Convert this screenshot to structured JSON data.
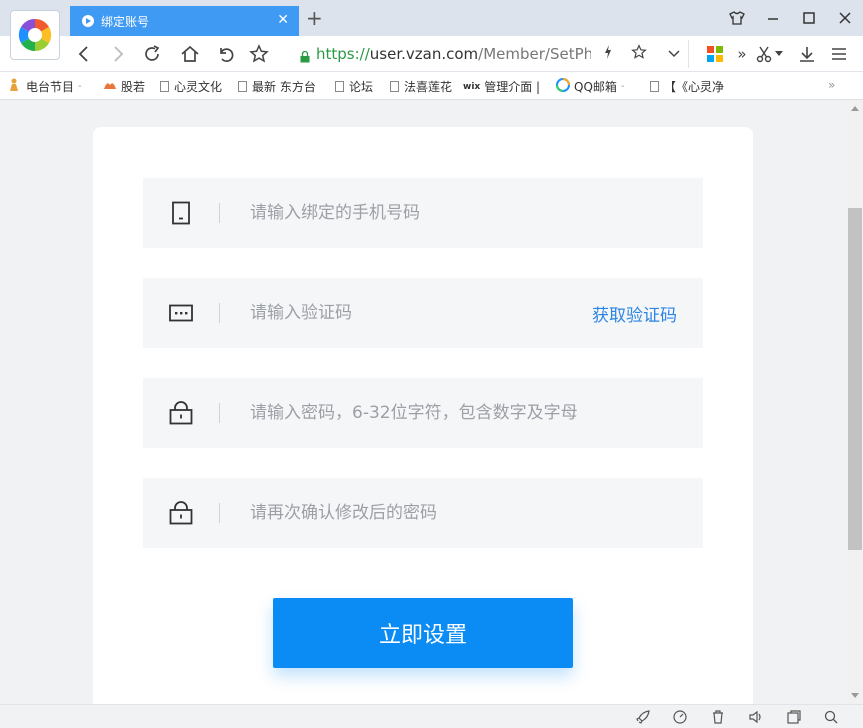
{
  "browser": {
    "tab_title": "绑定账号",
    "tab_close": "✕",
    "new_tab": "+",
    "window_controls": {
      "skin": "skin-icon",
      "minimize": "minimize-icon",
      "maximize": "maximize-icon",
      "close": "close-icon"
    },
    "address": {
      "scheme": "https://",
      "host": "user.vzan.com",
      "path": "/Member/SetPhon"
    },
    "toolbar_right_chevrons": "»"
  },
  "bookmarks": [
    {
      "label": "电台节目",
      "arrow": "-"
    },
    {
      "label": "股若"
    },
    {
      "label": "心灵文化"
    },
    {
      "label": "最新 东方台"
    },
    {
      "label": "论坛"
    },
    {
      "label": "法喜莲花"
    },
    {
      "label": "管理介面 |",
      "prefix": "wix"
    },
    {
      "label": "QQ邮箱",
      "arrow": "-"
    },
    {
      "label": "【"
    },
    {
      "label": "《心灵净"
    }
  ],
  "bookmarks_more": "»",
  "form": {
    "phone_placeholder": "请输入绑定的手机号码",
    "code_placeholder": "请输入验证码",
    "get_code_label": "获取验证码",
    "password_placeholder": "请输入密码，6-32位字符，包含数字及字母",
    "confirm_placeholder": "请再次确认修改后的密码",
    "submit_label": "立即设置"
  },
  "colors": {
    "accent": "#0b8cf5",
    "link": "#2b85e4",
    "tab_active": "#3f9af3",
    "secure": "#2a9a43"
  }
}
